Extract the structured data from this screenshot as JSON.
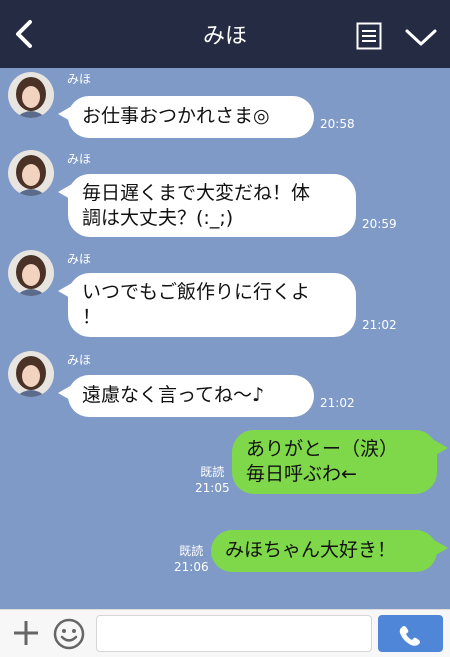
{
  "header": {
    "title": "みほ",
    "icons": [
      "chevron-left-icon",
      "note-icon",
      "chevron-down-icon"
    ]
  },
  "messages": [
    {
      "side": "left",
      "sender": "みほ",
      "lines": [
        "お仕事おつかれさま◎"
      ],
      "time": "20:58"
    },
    {
      "side": "left",
      "sender": "みほ",
      "lines": [
        "毎日遅くまで大変だね！体",
        "調は大丈夫？(:_;)"
      ],
      "time": "20:59"
    },
    {
      "side": "left",
      "sender": "みほ",
      "lines": [
        "いつでもご飯作りに行くよ",
        "！"
      ],
      "time": "21:02"
    },
    {
      "side": "left",
      "sender": "みほ",
      "lines": [
        "遠慮なく言ってね〜♪"
      ],
      "time": "21:02"
    },
    {
      "side": "right",
      "lines": [
        "ありがとー（涙）",
        "毎日呼ぶわ←"
      ],
      "read": "既読",
      "time": "21:05"
    },
    {
      "side": "right",
      "lines": [
        "みほちゃん大好き！"
      ],
      "read": "既読",
      "time": "21:06"
    }
  ],
  "colors": {
    "header": "#242b42",
    "background": "#7f9ac7",
    "outgoing": "#7fd84a",
    "incoming": "#ffffff",
    "send": "#4f86d8"
  },
  "footer": {
    "icons": [
      "plus-icon",
      "smile-icon",
      "phone-icon"
    ]
  }
}
